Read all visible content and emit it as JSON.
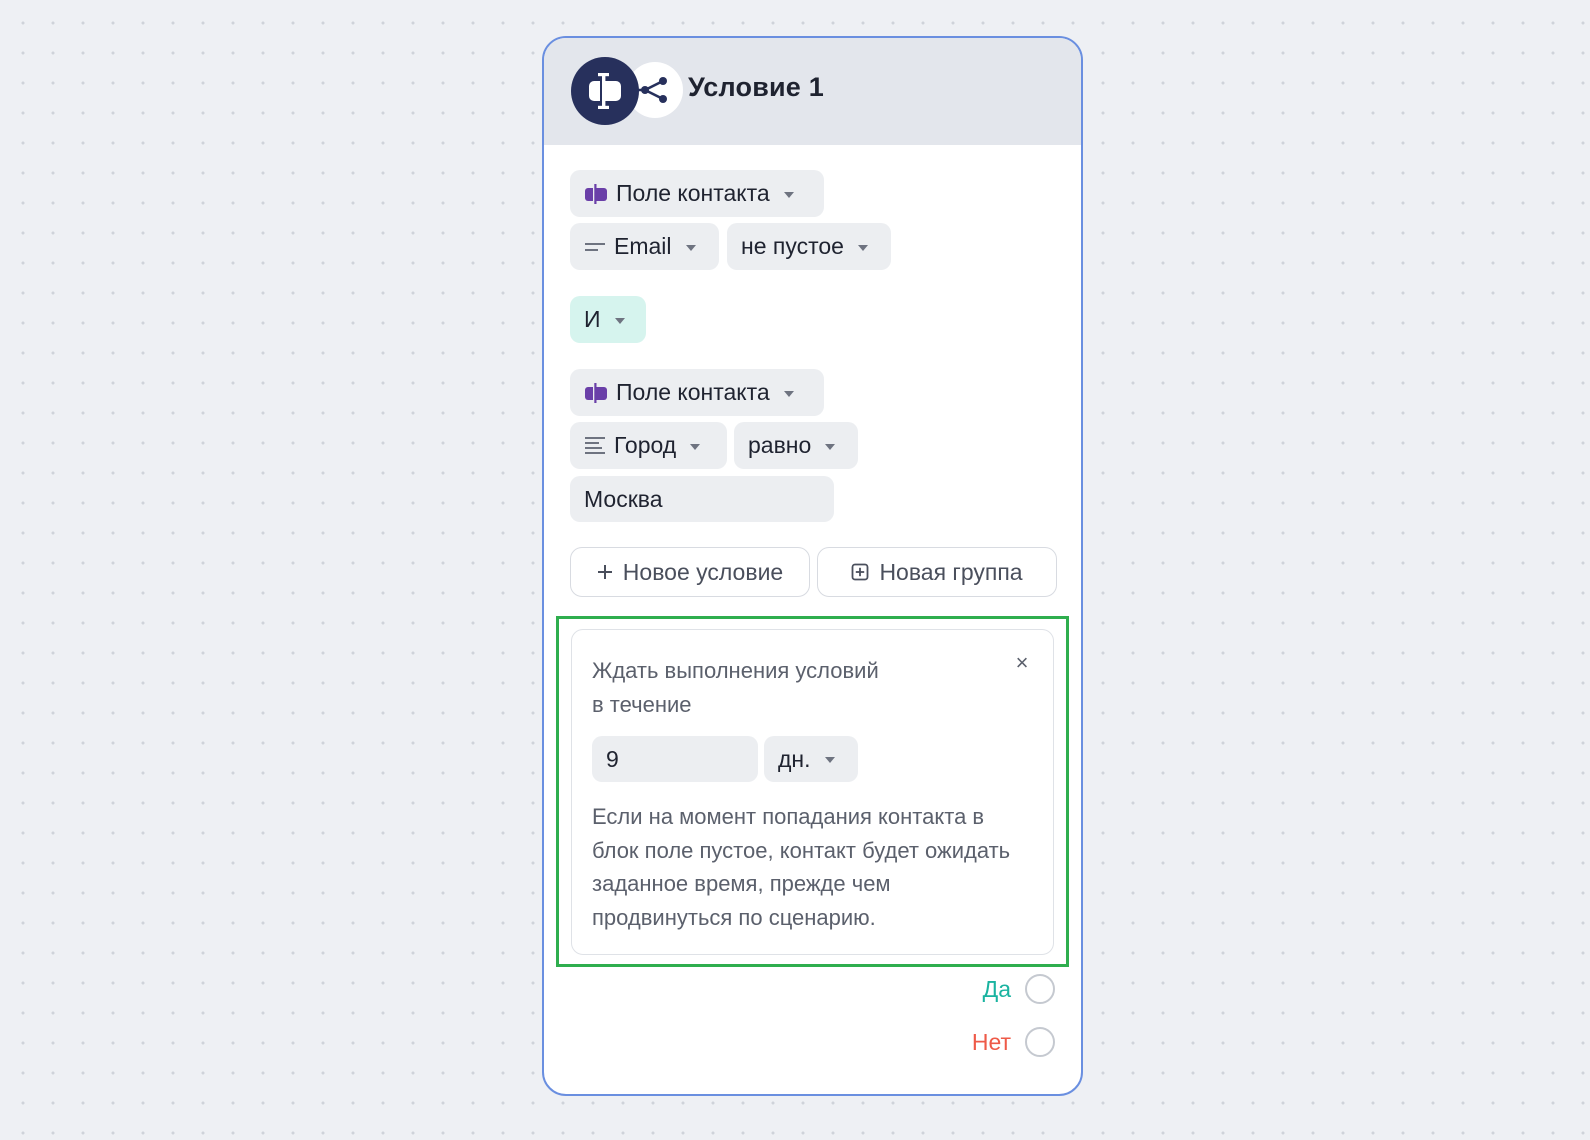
{
  "node": {
    "title": "Условие 1",
    "icons": {
      "main": "field-condition-icon",
      "secondary": "share-branch-icon"
    }
  },
  "condition1": {
    "source": {
      "label": "Поле контакта",
      "icon": "field-condition-icon"
    },
    "field": {
      "label": "Email",
      "icon": "short-text-icon"
    },
    "operator": {
      "label": "не пустое"
    }
  },
  "logic": {
    "label": "И"
  },
  "condition2": {
    "source": {
      "label": "Поле контакта",
      "icon": "field-condition-icon"
    },
    "field": {
      "label": "Город",
      "icon": "paragraph-icon"
    },
    "operator": {
      "label": "равно"
    },
    "value": "Москва"
  },
  "actions": {
    "new_condition": "Новое условие",
    "new_group": "Новая группа"
  },
  "wait": {
    "title": "Ждать выполнения условий в течение",
    "close": "×",
    "amount": "9",
    "unit": "дн.",
    "description": "Если на момент попадания контакта в блок поле пустое, контакт будет ожидать заданное время, прежде чем продвинуться по сценарию."
  },
  "outlets": {
    "yes": "Да",
    "no": "Нет"
  },
  "colors": {
    "accent_border": "#6a8fe0",
    "highlight": "#2fae4e",
    "yes": "#1ab3a0",
    "no": "#ee5a48",
    "icon_dark": "#27305c",
    "icon_purple": "#6a3fa8",
    "and_chip": "#d6f4ee"
  }
}
